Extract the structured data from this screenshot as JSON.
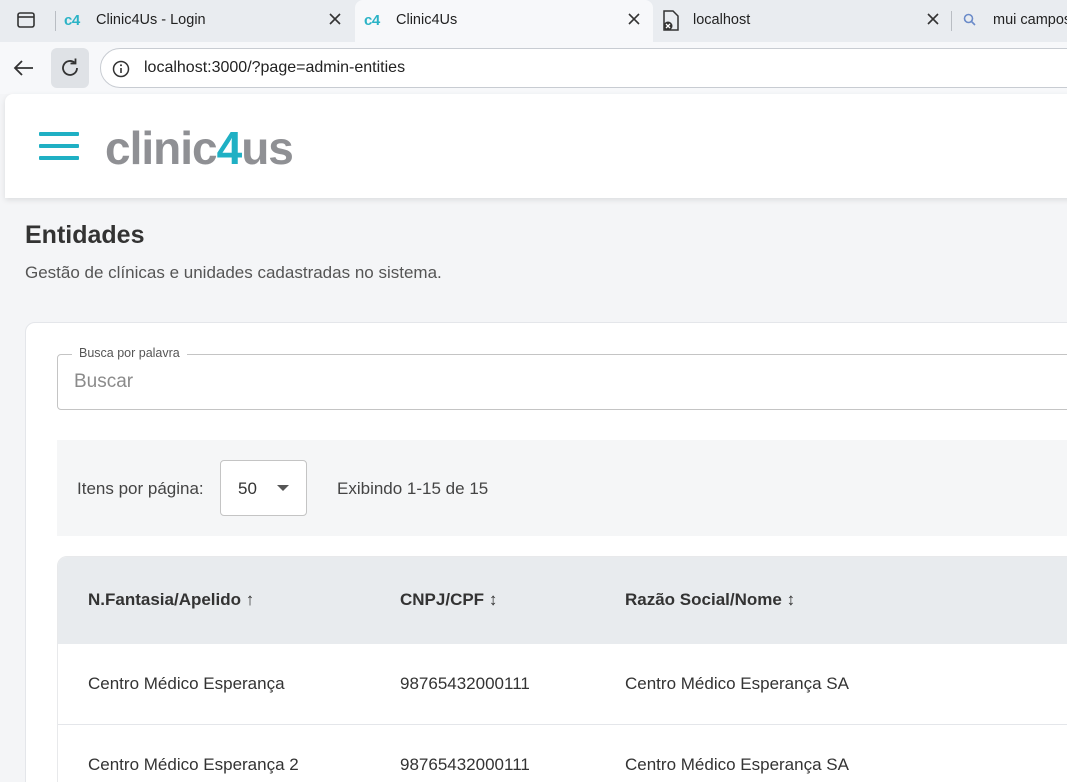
{
  "browser": {
    "tabs": [
      {
        "favicon": "c4",
        "title": "Clinic4Us - Login",
        "active": false
      },
      {
        "favicon": "c4",
        "title": "Clinic4Us",
        "active": true
      },
      {
        "favicon": "error-page-icon",
        "title": "localhost",
        "active": false
      },
      {
        "favicon": "search-icon",
        "title": "mui campos",
        "active": false
      }
    ],
    "url": "localhost:3000/?page=admin-entities"
  },
  "app": {
    "logo": {
      "part1": "clinic",
      "part2": "4",
      "part3": "us"
    },
    "accent_color": "#1fb0c4"
  },
  "page": {
    "title": "Entidades",
    "subtitle": "Gestão de clínicas e unidades cadastradas no sistema."
  },
  "search": {
    "label": "Busca por palavra",
    "placeholder": "Buscar",
    "value": ""
  },
  "pagination": {
    "label": "Itens por página:",
    "per_page": "50",
    "range_text": "Exibindo 1-15 de 15"
  },
  "table": {
    "columns": [
      {
        "label": "N.Fantasia/Apelido",
        "sort": "↑"
      },
      {
        "label": "CNPJ/CPF",
        "sort": "↕"
      },
      {
        "label": "Razão Social/Nome",
        "sort": "↕"
      }
    ],
    "rows": [
      [
        "Centro Médico Esperança",
        "98765432000111",
        "Centro Médico Esperança SA"
      ],
      [
        "Centro Médico Esperança 2",
        "98765432000111",
        "Centro Médico Esperança SA"
      ]
    ]
  }
}
